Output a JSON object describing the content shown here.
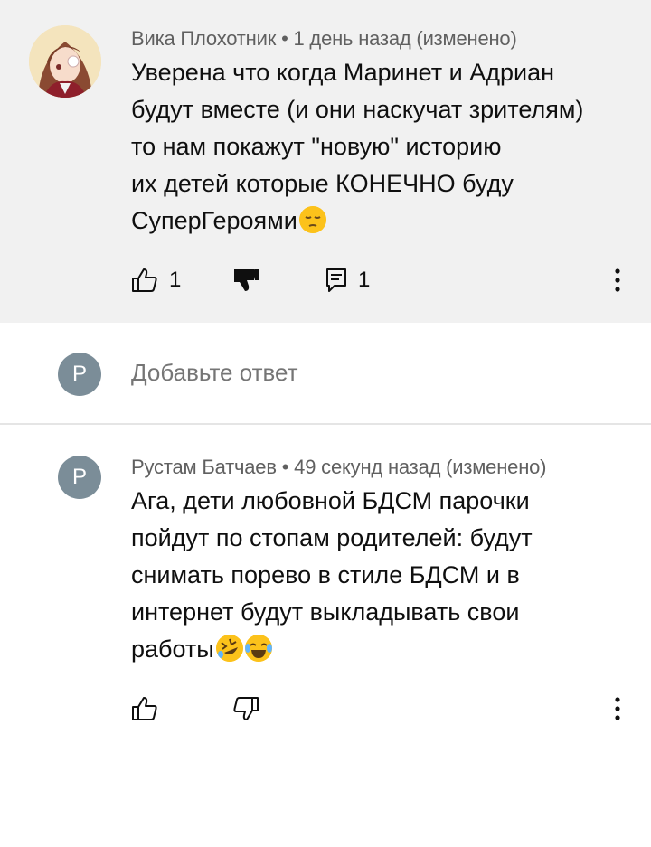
{
  "comments": [
    {
      "author": "Вика Плохотник",
      "time": "1 день назад (изменено)",
      "lines": [
        "Уверена что когда Маринет и Адриан",
        "будут вместе (и они наскучат зрителям)",
        "то нам покажут \"новую\" историю",
        "их детей которые КОНЕЧНО буду",
        "СуперГероями"
      ],
      "emoji": "pensive-face",
      "like_count": "1",
      "reply_count": "1"
    },
    {
      "author": "Рустам Батчаев",
      "time": "49 секунд назад (изменено)",
      "avatar_letter": "P",
      "lines": [
        "Ага, дети любовной БДСМ парочки",
        "пойдут по стопам родителей: будут",
        "снимать порево в стиле БДСМ и в",
        "интернет будут выкладывать свои",
        "работы"
      ],
      "emoji": [
        "rolling-laughing-face",
        "tears-of-joy-face"
      ]
    }
  ],
  "reply": {
    "avatar_letter": "P",
    "placeholder": "Добавьте ответ"
  },
  "separator": " • ",
  "colors": {
    "highlight_bg": "#f1f1f1",
    "avatar_gray": "#7b8d98",
    "meta_text": "#606060"
  }
}
